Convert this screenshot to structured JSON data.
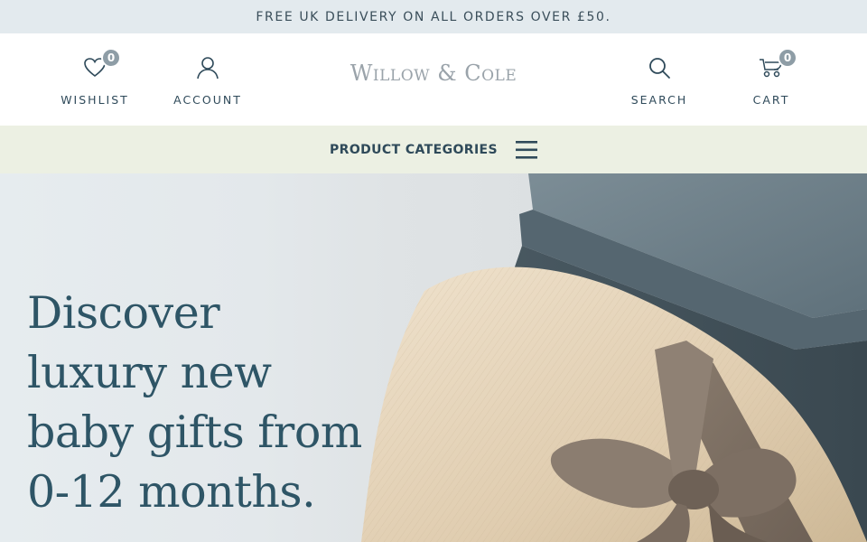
{
  "promo": {
    "text": "FREE UK DELIVERY ON ALL ORDERS OVER £50."
  },
  "header": {
    "wishlist": {
      "label": "WISHLIST",
      "count": "0"
    },
    "account": {
      "label": "ACCOUNT"
    },
    "logo": "Willow & Cole",
    "search": {
      "label": "SEARCH"
    },
    "cart": {
      "label": "CART",
      "count": "0"
    }
  },
  "categories": {
    "label": "PRODUCT CATEGORIES"
  },
  "hero": {
    "line1": "Discover",
    "line2": "luxury new",
    "line3": "baby gifts from",
    "line4": "0-12 months."
  },
  "colors": {
    "text": "#2f4a5a",
    "promo_bg": "#e3eaee",
    "category_bg": "#ecf0e3",
    "badge": "#8e9da6"
  }
}
